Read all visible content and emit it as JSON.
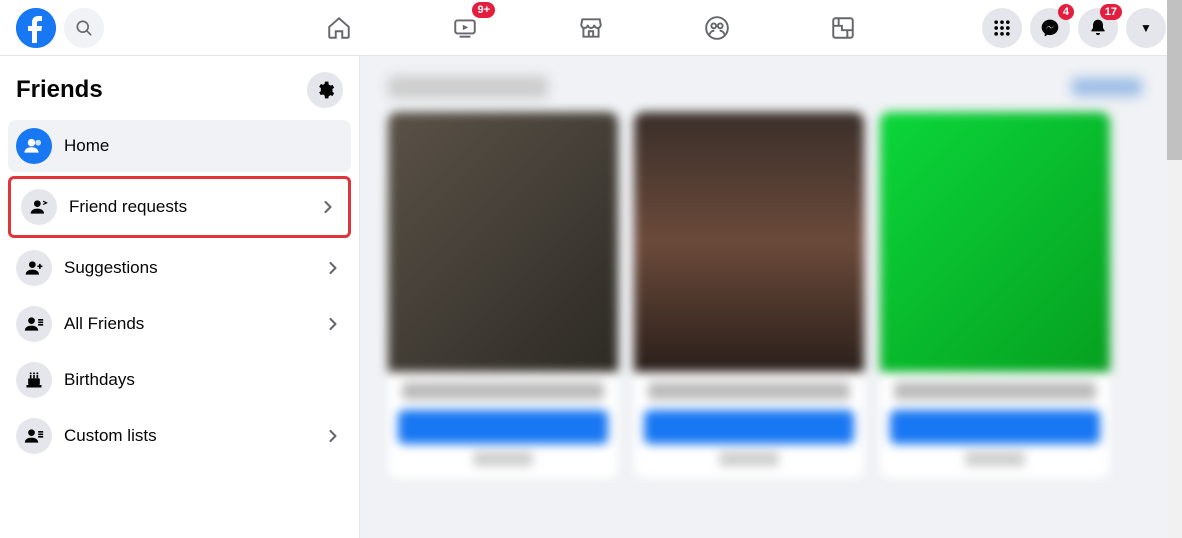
{
  "topnav": {
    "watch_badge": "9+",
    "messenger_badge": "4",
    "notifications_badge": "17"
  },
  "sidebar": {
    "title": "Friends",
    "items": [
      {
        "label": "Home",
        "has_chevron": false,
        "active": true
      },
      {
        "label": "Friend requests",
        "has_chevron": true,
        "highlighted": true
      },
      {
        "label": "Suggestions",
        "has_chevron": true
      },
      {
        "label": "All Friends",
        "has_chevron": true
      },
      {
        "label": "Birthdays",
        "has_chevron": false
      },
      {
        "label": "Custom lists",
        "has_chevron": true
      }
    ]
  }
}
